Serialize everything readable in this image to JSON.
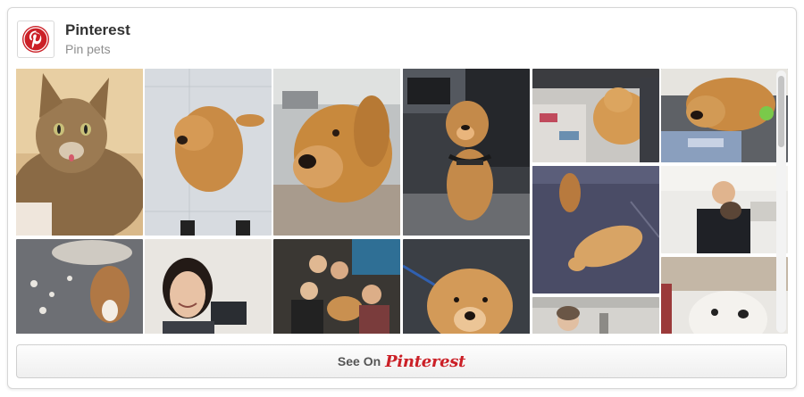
{
  "header": {
    "title": "Pinterest",
    "subtitle": "Pin pets"
  },
  "logo_icon": "pinterest-logo-icon",
  "colors": {
    "brand": "#cb2027",
    "title": "#333333",
    "subtitle": "#8e8e8e",
    "border": "#d6d6d6"
  },
  "footer": {
    "see_on_label": "See On",
    "brand_word": "Pinterest"
  },
  "pins": [
    {
      "subject": "tabby cat",
      "column": 1
    },
    {
      "subject": "cat on carpet with torn paper",
      "column": 1
    },
    {
      "subject": "golden retriever on floor",
      "column": 2
    },
    {
      "subject": "smiling woman",
      "column": 2
    },
    {
      "subject": "golden retriever close-up",
      "column": 3
    },
    {
      "subject": "group of people with dog",
      "column": 3
    },
    {
      "subject": "dog with harness in office",
      "column": 4
    },
    {
      "subject": "puppy close-up",
      "column": 4
    },
    {
      "subject": "golden retriever lying at desk",
      "column": 5
    },
    {
      "subject": "dogs lying on floor",
      "column": 5
    },
    {
      "subject": "woman in office",
      "column": 5
    },
    {
      "subject": "dog resting on blanket",
      "column": 6
    },
    {
      "subject": "man holding small dog",
      "column": 6
    },
    {
      "subject": "white dog close-up",
      "column": 6
    }
  ]
}
